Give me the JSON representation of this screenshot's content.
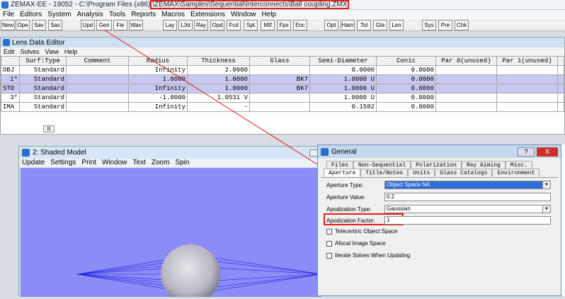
{
  "window_title_prefix": "ZEMAX-EE - 19052 - C:\\Program Files (x86)",
  "window_title_path": "\\ZEMAX\\Samples\\Sequential\\Interconnects\\Ball coupling.ZMX",
  "menu": [
    "File",
    "Editors",
    "System",
    "Analysis",
    "Tools",
    "Reports",
    "Macros",
    "Extensions",
    "Window",
    "Help"
  ],
  "toolbar": [
    "New",
    "Ope",
    "Sav",
    "Sas",
    "Upd",
    "Gen",
    "Fie",
    "Wav",
    "Lay",
    "L3d",
    "Ray",
    "Opd",
    "Fcd",
    "Spt",
    "Mtf",
    "Fps",
    "Enc",
    "Opt",
    "Ham",
    "Tol",
    "Gla",
    "Len",
    "Sys",
    "Pre",
    "Chk"
  ],
  "lde": {
    "title": "Lens Data Editor",
    "menu": [
      "Edit",
      "Solves",
      "View",
      "Help"
    ],
    "headers": [
      "Surf:Type",
      "Comment",
      "Radius",
      "Thickness",
      "Glass",
      "Semi-Diameter",
      "Conic",
      "Par 0(unused)",
      "Par 1(unused)"
    ],
    "rows": [
      {
        "surf": "OBJ",
        "type": "Standard",
        "comment": "",
        "radius": "Infinity",
        "thickness": "2.0000",
        "tflag": "",
        "glass": "",
        "semi": "0.0000",
        "sflag": "",
        "conic": "0.0000"
      },
      {
        "surf": "1*",
        "type": "Standard",
        "comment": "",
        "radius": "1.0000",
        "thickness": "1.0000",
        "tflag": "",
        "glass": "BK7",
        "semi": "1.0000",
        "sflag": "U",
        "conic": "0.0000"
      },
      {
        "surf": "STO",
        "type": "Standard",
        "comment": "",
        "radius": "Infinity",
        "thickness": "1.0000",
        "tflag": "",
        "glass": "BK7",
        "semi": "1.0000",
        "sflag": "U",
        "conic": "0.0000"
      },
      {
        "surf": "3*",
        "type": "Standard",
        "comment": "",
        "radius": "-1.0000",
        "thickness": "1.0531",
        "tflag": "V",
        "glass": "",
        "semi": "1.0000",
        "sflag": "U",
        "conic": "0.0000"
      },
      {
        "surf": "IMA",
        "type": "Standard",
        "comment": "",
        "radius": "Infinity",
        "thickness": "-",
        "tflag": "",
        "glass": "",
        "semi": "0.1582",
        "sflag": "",
        "conic": "0.0000"
      }
    ]
  },
  "shaded": {
    "title": "2: Shaded Model",
    "menu": [
      "Update",
      "Settings",
      "Print",
      "Window",
      "Text",
      "Zoom",
      "Spin"
    ]
  },
  "general": {
    "title": "General",
    "help_btn": "?",
    "close_btn": "X",
    "tabs_row1": [
      "Files",
      "Non-Sequential",
      "Polarization",
      "Ray Aiming",
      "Misc."
    ],
    "tabs_row2": [
      "Aperture",
      "Title/Notes",
      "Units",
      "Glass Catalogs",
      "Environment"
    ],
    "aperture_type_label": "Aperture Type:",
    "aperture_type_value": "Object Space NA",
    "aperture_value_label": "Aperture Value:",
    "aperture_value": "0.2",
    "apod_type_label": "Apodization Type:",
    "apod_type_value": "Gaussian",
    "apod_factor_label": "Apodization Factor:",
    "apod_factor_value": "1",
    "check1": "Telecentric Object Space",
    "check2": "Afocal Image Space",
    "check3": "Iterate Solves When Updating"
  },
  "colors": {
    "highlight": "#e0201c",
    "selected_row": "#c8c8f0",
    "canvas": "#8c8cf8",
    "rays": "#1a1adc"
  }
}
